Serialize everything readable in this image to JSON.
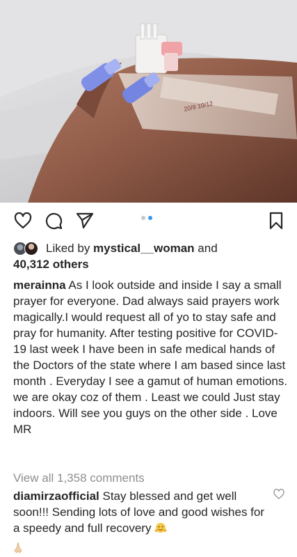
{
  "post": {
    "image_alt": "hand with IV cannula",
    "carousel": {
      "count": 2,
      "active_index": 1
    }
  },
  "actions": {
    "like_icon": "heart-outline-icon",
    "comment_icon": "comment-bubble-icon",
    "share_icon": "paper-plane-icon",
    "save_icon": "bookmark-icon"
  },
  "likes": {
    "prefix": "Liked by ",
    "user": "mystical__woman",
    "middle": " and",
    "others": "40,312 others"
  },
  "caption": {
    "username": "merainna",
    "text": " As I look outside and inside I say a small prayer for everyone. Dad always said prayers work magically.I would request all of yo to stay safe and pray for humanity. After testing positive for COVID-19 last week I have been in safe medical hands of the Doctors of the state where I am based since last month . Everyday I see a gamut of human emotions. we are okay coz of them . Least we could Just stay indoors. Will see you guys on the other side . Love MR"
  },
  "view_all_comments": "View all 1,358 comments",
  "top_comment": {
    "username": "diamirzaofficial",
    "text": " Stay blessed and get well soon!!! Sending lots of love and good wishes for a speedy and full recovery ",
    "emoji_1": "hugging-face-emoji",
    "emoji_2": "folded-hands-emoji"
  },
  "colors": {
    "text": "#262626",
    "muted": "#8e8e8e",
    "carousel_active": "#3897f0",
    "carousel_inactive": "#c7c7c7"
  }
}
